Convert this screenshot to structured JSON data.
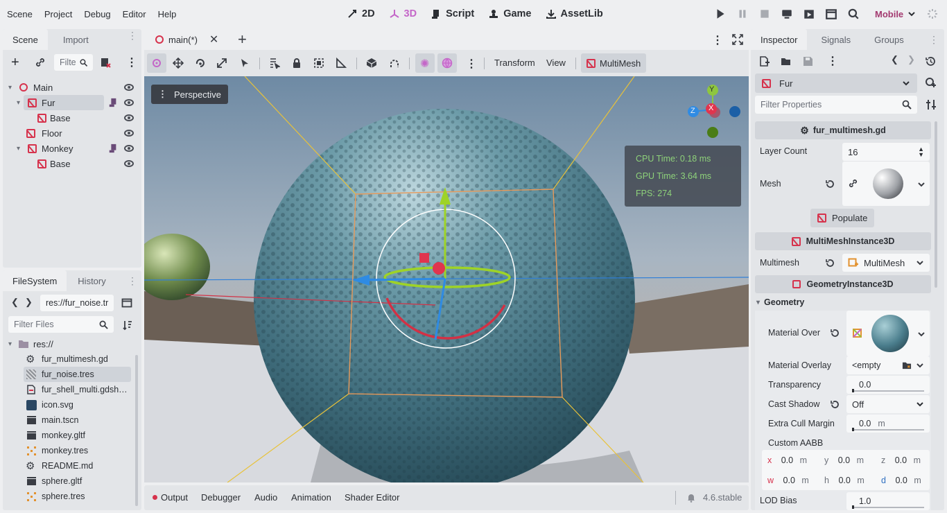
{
  "menu": [
    "Scene",
    "Project",
    "Debug",
    "Editor",
    "Help"
  ],
  "workspaces": [
    {
      "label": "2D",
      "icon": "2d-icon"
    },
    {
      "label": "3D",
      "icon": "3d-icon",
      "active": true
    },
    {
      "label": "Script",
      "icon": "script-icon"
    },
    {
      "label": "Game",
      "icon": "game-icon"
    },
    {
      "label": "AssetLib",
      "icon": "assetlib-icon"
    }
  ],
  "renderer": "Mobile",
  "scene_dock": {
    "tabs": [
      "Scene",
      "Import"
    ],
    "filter_placeholder": "Filte",
    "tree": [
      {
        "label": "Main",
        "icon": "node3d-icon",
        "depth": 0
      },
      {
        "label": "Fur",
        "icon": "multimesh-icon",
        "depth": 1,
        "selected": true,
        "script": true
      },
      {
        "label": "Base",
        "icon": "mesh-icon",
        "depth": 2
      },
      {
        "label": "Floor",
        "icon": "mesh-icon",
        "depth": 1
      },
      {
        "label": "Monkey",
        "icon": "multimesh-icon",
        "depth": 1,
        "script": true
      },
      {
        "label": "Base",
        "icon": "mesh-icon",
        "depth": 2
      }
    ]
  },
  "filesystem_dock": {
    "tabs": [
      "FileSystem",
      "History"
    ],
    "path": "res://fur_noise.tr",
    "filter_placeholder": "Filter Files",
    "root": "res://",
    "files": [
      {
        "name": "fur_multimesh.gd",
        "icon": "gear-icon"
      },
      {
        "name": "fur_noise.tres",
        "icon": "noise-icon",
        "selected": true
      },
      {
        "name": "fur_shell_multi.gdsh…",
        "icon": "shader-icon"
      },
      {
        "name": "icon.svg",
        "icon": "image-icon"
      },
      {
        "name": "main.tscn",
        "icon": "scene-icon"
      },
      {
        "name": "monkey.gltf",
        "icon": "scene-icon"
      },
      {
        "name": "monkey.tres",
        "icon": "resource-icon"
      },
      {
        "name": "README.md",
        "icon": "text-icon"
      },
      {
        "name": "sphere.gltf",
        "icon": "scene-icon"
      },
      {
        "name": "sphere.tres",
        "icon": "resource-icon"
      }
    ]
  },
  "editor": {
    "tab_label": "main(*)",
    "toolbar": {
      "transform": "Transform",
      "view": "View",
      "multimesh": "MultiMesh"
    },
    "viewport": {
      "perspective": "Perspective",
      "cpu_time": "CPU Time: 0.18 ms",
      "gpu_time": "GPU Time: 3.64 ms",
      "fps": "FPS: 274",
      "gizmo": {
        "x": "X",
        "y": "Y",
        "z": "Z"
      }
    }
  },
  "bottom_panel": {
    "tabs": [
      "Output",
      "Debugger",
      "Audio",
      "Animation",
      "Shader Editor"
    ],
    "version": "4.6.stable"
  },
  "inspector": {
    "tabs": [
      "Inspector",
      "Signals",
      "Groups"
    ],
    "node_name": "Fur",
    "filter_placeholder": "Filter Properties",
    "script_section": "fur_multimesh.gd",
    "layer_count_label": "Layer Count",
    "layer_count": "16",
    "mesh_label": "Mesh",
    "populate_label": "Populate",
    "mmi_section": "MultiMeshInstance3D",
    "multimesh_label": "Multimesh",
    "multimesh_value": "MultiMesh",
    "gi_section": "GeometryInstance3D",
    "geometry_group": "Geometry",
    "material_override_label": "Material Over",
    "material_overlay_label": "Material Overlay",
    "material_overlay_value": "<empty",
    "transparency_label": "Transparency",
    "transparency_value": "0.0",
    "cast_shadow_label": "Cast Shadow",
    "cast_shadow_value": "Off",
    "extra_cull_label": "Extra Cull Margin",
    "extra_cull_value": "0.0",
    "extra_cull_unit": "m",
    "custom_aabb_label": "Custom AABB",
    "aabb": [
      {
        "axis": "x",
        "value": "0.0",
        "unit": "m"
      },
      {
        "axis": "y",
        "value": "0.0",
        "unit": "m"
      },
      {
        "axis": "z",
        "value": "0.0",
        "unit": "m"
      },
      {
        "axis": "w",
        "value": "0.0",
        "unit": "m"
      },
      {
        "axis": "h",
        "value": "0.0",
        "unit": "m"
      },
      {
        "axis": "d",
        "value": "0.0",
        "unit": "m"
      }
    ],
    "lod_bias_label": "LOD Bias",
    "lod_bias_value": "1.0"
  },
  "colors": {
    "accent_3d": "#c466c8",
    "node_red": "#d6324c",
    "renderer": "#a33a70",
    "fps_green": "#8ed27a",
    "sky": "#8ea3b9",
    "fur": "#4a7d8c"
  }
}
